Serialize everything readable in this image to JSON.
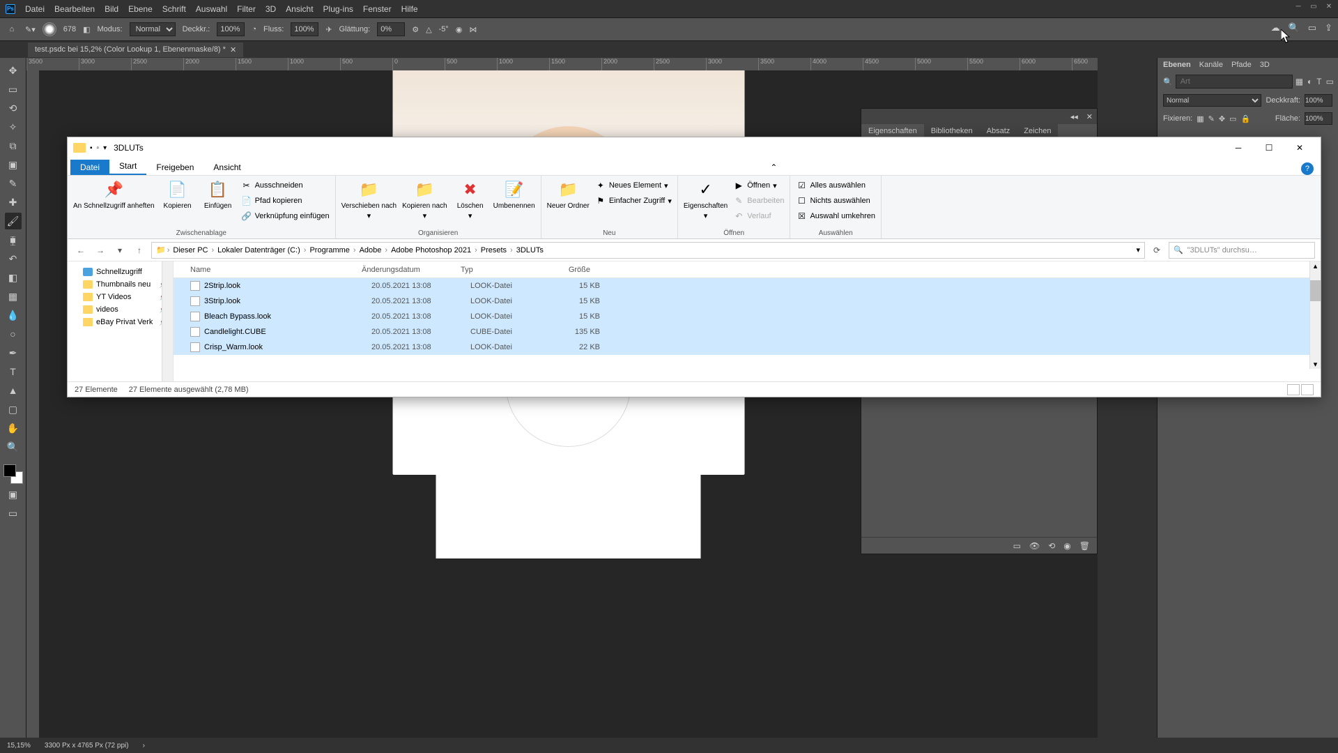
{
  "ps_menu": [
    "Datei",
    "Bearbeiten",
    "Bild",
    "Ebene",
    "Schrift",
    "Auswahl",
    "Filter",
    "3D",
    "Ansicht",
    "Plug-ins",
    "Fenster",
    "Hilfe"
  ],
  "options": {
    "brush_size": "678",
    "modus": "Modus:",
    "modus_val": "Normal",
    "deckkr": "Deckkr.:",
    "deckkr_val": "100%",
    "fluss": "Fluss:",
    "fluss_val": "100%",
    "glaettung": "Glättung:",
    "glaettung_val": "0%",
    "angle": "-5°"
  },
  "doc_tab": "test.psdc bei 15,2% (Color Lookup 1, Ebenenmaske/8) *",
  "ruler_marks": [
    "3500",
    "3000",
    "2500",
    "2000",
    "1500",
    "1000",
    "500",
    "0",
    "500",
    "1000",
    "1500",
    "2000",
    "2500",
    "3000",
    "3500",
    "4000",
    "4500",
    "5000",
    "5500",
    "6000",
    "6500"
  ],
  "props_panel": {
    "tabs": [
      "Eigenschaften",
      "Bibliotheken",
      "Absatz",
      "Zeichen"
    ]
  },
  "right": {
    "tabs": [
      "Ebenen",
      "Kanäle",
      "Pfade",
      "3D"
    ],
    "search_ph": "Art",
    "blend": "Normal",
    "deck": "Deckkraft:",
    "deck_val": "100%",
    "fix": "Fixieren:",
    "flaeche": "Fläche:",
    "flaeche_val": "100%"
  },
  "status": {
    "zoom": "15,15%",
    "dims": "3300 Px x 4765 Px (72 ppi)"
  },
  "explorer": {
    "title": "3DLUTs",
    "ribtabs": {
      "file": "Datei",
      "start": "Start",
      "share": "Freigeben",
      "view": "Ansicht"
    },
    "groups": {
      "clipboard": "Zwischenablage",
      "organize": "Organisieren",
      "new": "Neu",
      "open": "Öffnen",
      "select": "Auswählen"
    },
    "btns": {
      "pin": "An Schnellzugriff\nanheften",
      "copy": "Kopieren",
      "paste": "Einfügen",
      "cut": "Ausschneiden",
      "copypath": "Pfad kopieren",
      "pastelink": "Verknüpfung einfügen",
      "moveto": "Verschieben\nnach",
      "copyto": "Kopieren\nnach",
      "delete": "Löschen",
      "rename": "Umbenennen",
      "newfolder": "Neuer\nOrdner",
      "newitem": "Neues Element",
      "easyaccess": "Einfacher Zugriff",
      "properties": "Eigenschaften",
      "open": "Öffnen",
      "edit": "Bearbeiten",
      "history": "Verlauf",
      "selectall": "Alles auswählen",
      "selectnone": "Nichts auswählen",
      "invert": "Auswahl umkehren"
    },
    "breadcrumb": [
      "Dieser PC",
      "Lokaler Datenträger (C:)",
      "Programme",
      "Adobe",
      "Adobe Photoshop 2021",
      "Presets",
      "3DLUTs"
    ],
    "search_ph": "\"3DLUTs\" durchsu…",
    "tree": {
      "quickaccess": "Schnellzugriff",
      "items": [
        "Thumbnails neu",
        "YT Videos",
        "videos",
        "eBay Privat Verk"
      ]
    },
    "columns": {
      "name": "Name",
      "date": "Änderungsdatum",
      "type": "Typ",
      "size": "Größe"
    },
    "files": [
      {
        "name": "2Strip.look",
        "date": "20.05.2021 13:08",
        "type": "LOOK-Datei",
        "size": "15 KB",
        "sel": true
      },
      {
        "name": "3Strip.look",
        "date": "20.05.2021 13:08",
        "type": "LOOK-Datei",
        "size": "15 KB",
        "sel": true
      },
      {
        "name": "Bleach Bypass.look",
        "date": "20.05.2021 13:08",
        "type": "LOOK-Datei",
        "size": "15 KB",
        "sel": true
      },
      {
        "name": "Candlelight.CUBE",
        "date": "20.05.2021 13:08",
        "type": "CUBE-Datei",
        "size": "135 KB",
        "sel": true
      },
      {
        "name": "Crisp_Warm.look",
        "date": "20.05.2021 13:08",
        "type": "LOOK-Datei",
        "size": "22 KB",
        "sel": true
      }
    ],
    "status": {
      "count": "27 Elemente",
      "selected": "27 Elemente ausgewählt (2,78 MB)"
    }
  }
}
